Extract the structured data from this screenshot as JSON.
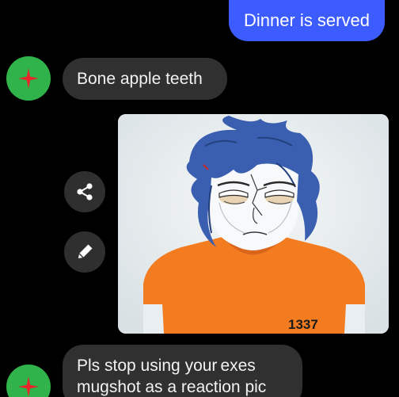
{
  "messages": {
    "outgoing_1": "Dinner is served",
    "incoming_1": "Bone apple teeth",
    "incoming_2_line_1": "Pls stop using your",
    "incoming_2_overlay": "exes",
    "incoming_2_line_2": "mugshot as a reaction pic"
  },
  "image": {
    "shirt_number": "1337"
  },
  "actions": {
    "share_icon": "share-icon",
    "edit_icon": "pencil-icon"
  },
  "colors": {
    "outgoing_bubble": "#3d5cff",
    "incoming_bubble": "#303030",
    "avatar_bg": "#2fb34a",
    "avatar_star": "#e8262c",
    "background": "#000000"
  }
}
